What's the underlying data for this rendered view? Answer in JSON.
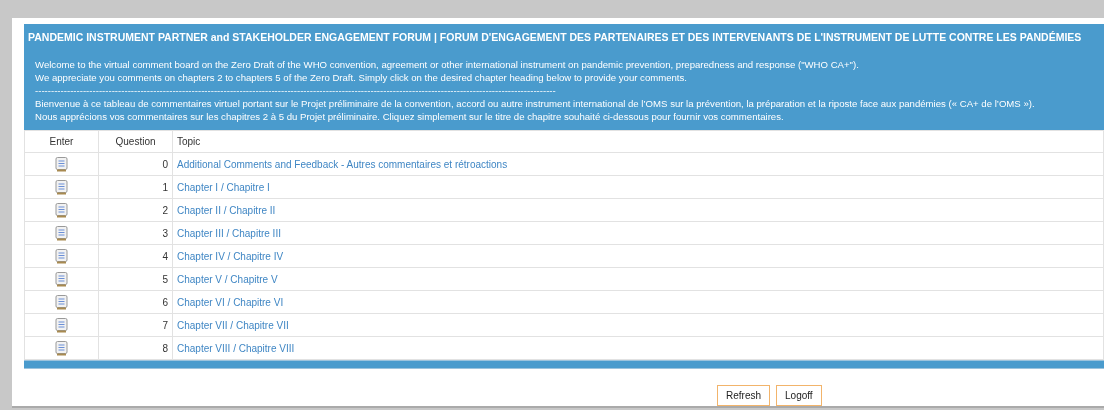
{
  "header": {
    "title": "PANDEMIC INSTRUMENT PARTNER and STAKEHOLDER ENGAGEMENT FORUM | FORUM D'ENGAGEMENT DES PARTENAIRES ET DES INTERVENANTS DE L'INSTRUMENT DE LUTTE CONTRE LES PANDÉMIES",
    "lines": [
      "Welcome to the virtual comment board on the Zero Draft of the WHO convention, agreement or other international instrument on pandemic prevention, preparedness and response (\"WHO CA+\").",
      "We appreciate you comments on chapters 2 to chapters 5 of the Zero Draft. Simply click on the desired chapter heading below to provide your comments.",
      "-------------------------------------------------------------------------------------------------------------------------------------------------------------------",
      "Bienvenue à ce tableau de commentaires virtuel portant sur le Projet préliminaire de la convention, accord ou autre instrument international de l’OMS sur la prévention, la préparation et la riposte face aux pandémies (« CA+ de l’OMS »).",
      "Nous apprécions vos commentaires sur les chapitres 2 à 5 du Projet préliminaire. Cliquez simplement sur le titre de chapitre souhaité ci-dessous pour fournir vos commentaires."
    ]
  },
  "table": {
    "columns": [
      "Enter",
      "Question",
      "Topic"
    ],
    "rows": [
      {
        "question": "0",
        "topic": "Additional Comments and Feedback - Autres commentaires et rétroactions"
      },
      {
        "question": "1",
        "topic": "Chapter I / Chapitre I"
      },
      {
        "question": "2",
        "topic": "Chapter II / Chapitre II"
      },
      {
        "question": "3",
        "topic": "Chapter III / Chapitre III"
      },
      {
        "question": "4",
        "topic": "Chapter IV / Chapitre IV"
      },
      {
        "question": "5",
        "topic": "Chapter V / Chapitre V"
      },
      {
        "question": "6",
        "topic": "Chapter VI / Chapitre VI"
      },
      {
        "question": "7",
        "topic": "Chapter VII / Chapitre VII"
      },
      {
        "question": "8",
        "topic": "Chapter VIII / Chapitre VIII"
      }
    ]
  },
  "buttons": [
    "Refresh",
    "Logoff"
  ]
}
